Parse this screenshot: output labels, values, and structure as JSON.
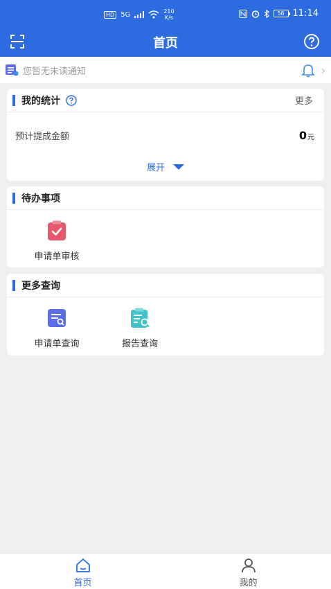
{
  "status_bar": {
    "hd": "HD",
    "network": "5G",
    "speed_value": "210",
    "speed_unit": "K/s",
    "battery": "56",
    "time": "11:14"
  },
  "nav": {
    "title": "首页"
  },
  "notice": {
    "text": "您暂无未读通知"
  },
  "stats": {
    "title": "我的统计",
    "more_label": "更多",
    "row_label": "预计提成金额",
    "row_value": "0",
    "row_unit": "元",
    "expand_label": "展开"
  },
  "todo": {
    "title": "待办事项",
    "items": [
      {
        "label": "申请单审核",
        "icon": "clipboard-check-icon"
      }
    ]
  },
  "query": {
    "title": "更多查询",
    "items": [
      {
        "label": "申请单查询",
        "icon": "doc-search-icon"
      },
      {
        "label": "报告查询",
        "icon": "report-search-icon"
      }
    ]
  },
  "tabbar": {
    "tabs": [
      {
        "label": "首页",
        "icon": "home-icon",
        "active": true
      },
      {
        "label": "我的",
        "icon": "user-icon",
        "active": false
      }
    ]
  },
  "colors": {
    "primary": "#2c6be0",
    "background": "#efefef",
    "todo_icon": "#e8586c",
    "query_icon_1": "#5b6ee8",
    "query_icon_2": "#3fc3c8"
  }
}
